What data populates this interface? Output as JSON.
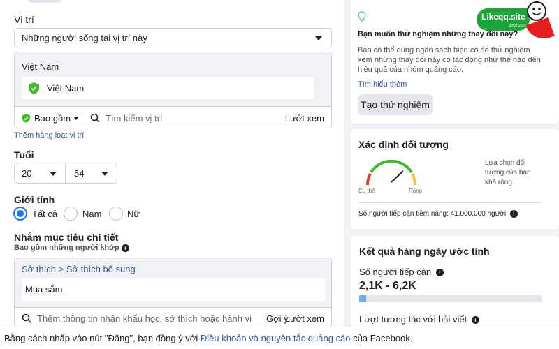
{
  "location": {
    "label": "Vị trí",
    "mode": "Những người sống tại vị trí này",
    "group_title": "Việt Nam",
    "selected": "Việt Nam",
    "include_label": "Bao gồm",
    "search_placeholder": "Tìm kiếm vị trí",
    "browse": "Lướt xem",
    "bulk_link": "Thêm hàng loạt vị trí"
  },
  "age": {
    "label": "Tuổi",
    "min": "20",
    "max": "54"
  },
  "gender": {
    "label": "Giới tính",
    "options": [
      "Tất cả",
      "Nam",
      "Nữ"
    ],
    "selected": "Tất cả"
  },
  "detailed": {
    "label": "Nhắm mục tiêu chi tiết",
    "sublabel": "Bao gồm những người khớp",
    "breadcrumb_1": "Sở thích",
    "breadcrumb_sep": ">",
    "breadcrumb_2": "Sở thích bổ sung",
    "item": "Mua sắm",
    "search_placeholder": "Thêm thông tin nhân khẩu học, sở thích hoặc hành vi",
    "suggest": "Gợi ý",
    "browse": "Lướt xem"
  },
  "experiment_card": {
    "title": "Bạn muốn thử nghiệm những thay đổi này?",
    "body": "Bạn có thể dùng ngân sách hiện có để thử nghiệm xem những thay đổi này có tác động như thế nào đến hiệu quả của nhóm quảng cáo.",
    "learn_more": "Tìm hiểu thêm",
    "button": "Tạo thử nghiệm"
  },
  "logo": {
    "text": "Likeqq.site",
    "sub": "Since 2015"
  },
  "audience_card": {
    "title": "Xác định đối tượng",
    "gauge_left": "Cụ thể",
    "gauge_right": "Rộng",
    "description": "Lựa chọn đối tượng của bạn khá rộng.",
    "reach": "Số người tiếp cận tiềm năng: 41.000.000 người"
  },
  "results_card": {
    "title": "Kết quả hàng ngày ước tính",
    "reach_label": "Số người tiếp cận",
    "reach_value": "2,1K - 6,2K",
    "reach_progress": 0.04,
    "engagement_label": "Lượt tương tác với bài viết"
  },
  "footer": {
    "prefix": "Bằng cách nhấp vào nút \"Đăng\", bạn đồng ý với ",
    "link": "Điều khoản và nguyên tắc quảng cáo",
    "suffix": " của Facebook."
  },
  "colors": {
    "accent": "#1877f2",
    "link": "#385898",
    "include_green": "#42b72a",
    "logo_green": "#1ca63a",
    "progress_fill": "#6ab0ee"
  }
}
